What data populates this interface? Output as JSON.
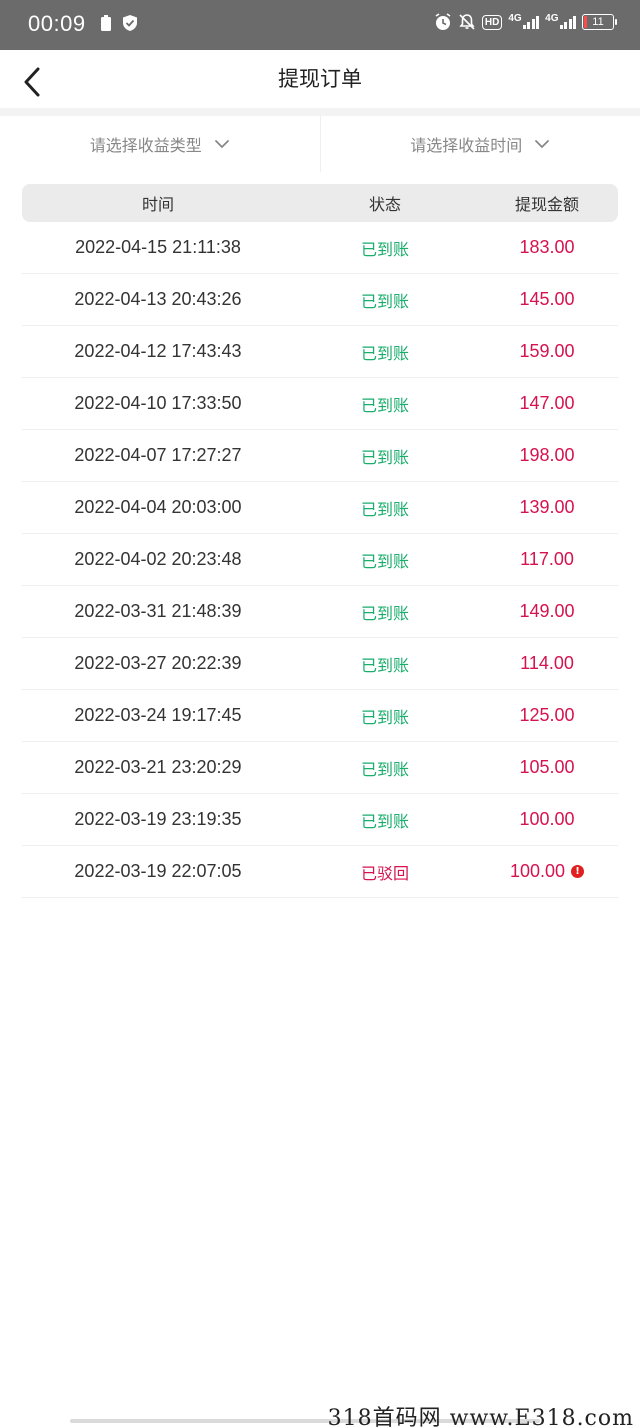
{
  "status_bar": {
    "time": "00:09",
    "network_1": "4G",
    "network_2": "4G",
    "hd": "HD",
    "battery": "11"
  },
  "header": {
    "title": "提现订单"
  },
  "filters": {
    "type_placeholder": "请选择收益类型",
    "time_placeholder": "请选择收益时间"
  },
  "table": {
    "headers": {
      "time": "时间",
      "status": "状态",
      "amount": "提现金额"
    },
    "rows": [
      {
        "time": "2022-04-15 21:11:38",
        "status": "已到账",
        "amount": "183.00"
      },
      {
        "time": "2022-04-13 20:43:26",
        "status": "已到账",
        "amount": "145.00"
      },
      {
        "time": "2022-04-12 17:43:43",
        "status": "已到账",
        "amount": "159.00"
      },
      {
        "time": "2022-04-10 17:33:50",
        "status": "已到账",
        "amount": "147.00"
      },
      {
        "time": "2022-04-07 17:27:27",
        "status": "已到账",
        "amount": "198.00"
      },
      {
        "time": "2022-04-04 20:03:00",
        "status": "已到账",
        "amount": "139.00"
      },
      {
        "time": "2022-04-02 20:23:48",
        "status": "已到账",
        "amount": "117.00"
      },
      {
        "time": "2022-03-31 21:48:39",
        "status": "已到账",
        "amount": "149.00"
      },
      {
        "time": "2022-03-27 20:22:39",
        "status": "已到账",
        "amount": "114.00"
      },
      {
        "time": "2022-03-24 19:17:45",
        "status": "已到账",
        "amount": "125.00"
      },
      {
        "time": "2022-03-21 23:20:29",
        "status": "已到账",
        "amount": "105.00"
      },
      {
        "time": "2022-03-19 23:19:35",
        "status": "已到账",
        "amount": "100.00"
      },
      {
        "time": "2022-03-19 22:07:05",
        "status": "已驳回",
        "amount": "100.00"
      }
    ],
    "alert_symbol": "!"
  },
  "colors": {
    "success": "#1aad6c",
    "rejected": "#d6134f",
    "amount": "#d6134f"
  },
  "watermark": "318首码网 www.E318.com"
}
